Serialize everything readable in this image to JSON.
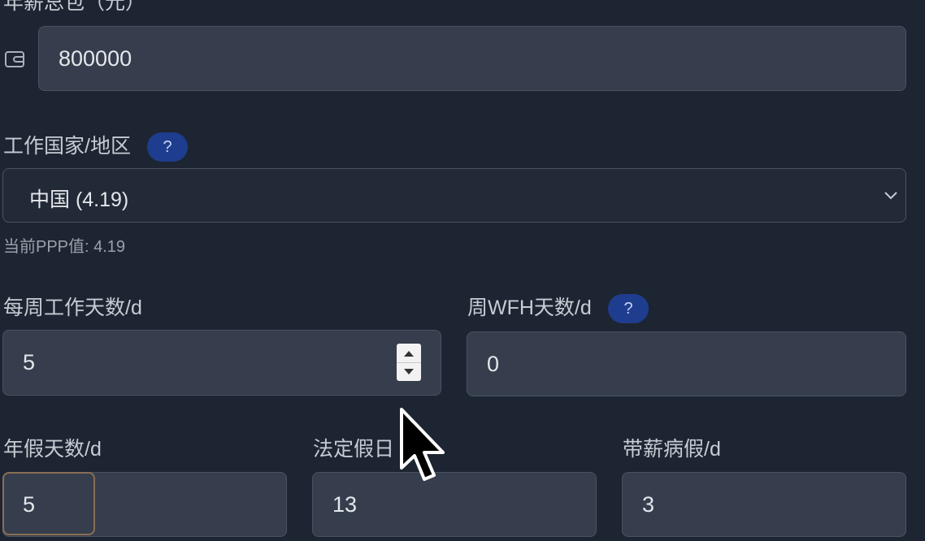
{
  "salary": {
    "label": "年薪总包（元）",
    "value": "800000",
    "icon": "wallet-icon"
  },
  "country": {
    "label": "工作国家/地区",
    "help_label": "?",
    "selected": "中国 (4.19)",
    "hint": "当前PPP值: 4.19"
  },
  "workdays": {
    "label": "每周工作天数/d",
    "value": "5"
  },
  "wfh": {
    "label": "周WFH天数/d",
    "help_label": "?",
    "value": "0"
  },
  "annual_leave": {
    "label": "年假天数/d",
    "value": "5"
  },
  "public_holidays": {
    "label": "法定假日",
    "value": "13"
  },
  "sick_leave": {
    "label": "带薪病假/d",
    "value": "3"
  },
  "colors": {
    "background": "#1e2532",
    "field": "#363e4d",
    "help_badge": "#1f3d8f",
    "focus_border": "#8a6e55"
  }
}
